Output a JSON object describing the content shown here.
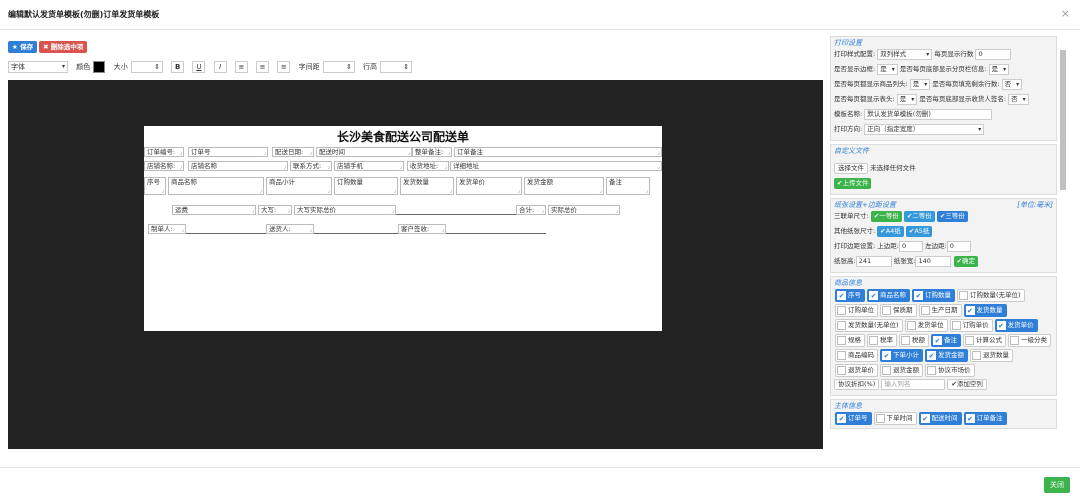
{
  "header": {
    "title": "编辑默认发货单模板(勿删)订单发货单模板",
    "close": "×"
  },
  "toolbar": {
    "save": "★ 保存",
    "delete": "✖ 删除选中项"
  },
  "format": {
    "font": "字体",
    "color": "颜色",
    "size": "大小",
    "bold": "B",
    "underline": "U",
    "italic": "I",
    "align_left": "≡",
    "align_center": "≡",
    "align_right": "≡",
    "letter_spacing": "字间距",
    "line_height": "行高"
  },
  "paper": {
    "title": "长沙美食配送公司配送单",
    "row1": [
      "订单编号:",
      "订单号",
      "配送日期:",
      "配送时间",
      "整单备注:",
      "订单备注"
    ],
    "row2": [
      "店铺名称:",
      "店铺名称",
      "联系方式:",
      "店铺手机",
      "收货地址:",
      "详细地址"
    ],
    "cols": [
      "序号",
      "商品名称",
      "商品小计",
      "订购数量",
      "发货数量",
      "发货单价",
      "发货金额",
      "备注"
    ],
    "row4": [
      "运费",
      "大写:",
      "大写实际总价",
      "合计:",
      "实际总价"
    ],
    "row5": [
      "制单人:",
      "送货人:",
      "客户签收:"
    ]
  },
  "panel": {
    "print_settings": {
      "title": "打印设置",
      "style_label": "打印样式配置:",
      "style_value": "双列样式",
      "rows_label": "每页显示行数",
      "rows_value": "0",
      "border_label": "是否显示边框:",
      "border_value": "是",
      "paging_label": "是否每页底部显示分页栏信息:",
      "paging_value": "是",
      "head_label": "是否每页都显示商品列头:",
      "head_value": "是",
      "fill_label": "是否每页填充剩余行数:",
      "fill_value": "否",
      "top_label": "是否每页都显示表头:",
      "top_value": "是",
      "sign_label": "是否每页底部显示收货人签名:",
      "sign_value": "否",
      "name_label": "模板名称:",
      "name_value": "默认发货单模板(勿删)",
      "dir_label": "打印方向:",
      "dir_value": "正向（指定宽度）"
    },
    "custom": {
      "title": "自定义文件",
      "choose": "选择文件",
      "none": "未选择任何文件",
      "upload": "✔上传文件"
    },
    "paper": {
      "title": "纸张设置+边距设置",
      "unit": "[单位:毫米]",
      "triple_label": "三联单尺寸:",
      "b1": "✔一等份",
      "b2": "✔二等份",
      "b3": "✔三等份",
      "other_label": "其他纸张尺寸:",
      "a4": "✔A4纸",
      "a5": "✔A5纸",
      "margin_label": "打印边距设置:",
      "top_label": "上边距:",
      "top_value": "0",
      "left_label": "左边距:",
      "left_value": "0",
      "h_label": "纸张高:",
      "h_value": "241",
      "w_label": "纸张宽:",
      "w_value": "140",
      "confirm": "✔确定"
    },
    "goods": {
      "title": "商品信息",
      "items": [
        [
          "序号",
          true
        ],
        [
          "商品名称",
          true
        ],
        [
          "订购数量",
          true
        ],
        [
          "订购数量(无单位)",
          false
        ],
        [
          "订购单位",
          false
        ],
        [
          "保质期",
          false
        ],
        [
          "生产日期",
          false
        ],
        [
          "发货数量",
          true
        ],
        [
          "发货数量(无单位)",
          false
        ],
        [
          "发货单位",
          false
        ],
        [
          "订购单价",
          false
        ],
        [
          "发货单价",
          true
        ],
        [
          "规格",
          false
        ],
        [
          "税率",
          false
        ],
        [
          "税额",
          false
        ],
        [
          "备注",
          true
        ],
        [
          "计算公式",
          false
        ],
        [
          "一级分类",
          false
        ],
        [
          "商品编码",
          false
        ],
        [
          "下单小计",
          true
        ],
        [
          "发货金额",
          true
        ],
        [
          "退货数量",
          false
        ],
        [
          "退货单价",
          false
        ],
        [
          "退货金额",
          false
        ],
        [
          "协议市场价",
          false
        ],
        [
          "协议折扣(%)",
          false
        ]
      ],
      "input_placeholder": "输入列名",
      "add": "✔添加空列"
    },
    "subject": {
      "title": "主体信息",
      "items": [
        [
          "订单号",
          true
        ],
        [
          "下单时间",
          false
        ],
        [
          "配送时间",
          true
        ],
        [
          "订单备注",
          true
        ]
      ]
    }
  },
  "footer": {
    "close": "关闭"
  }
}
